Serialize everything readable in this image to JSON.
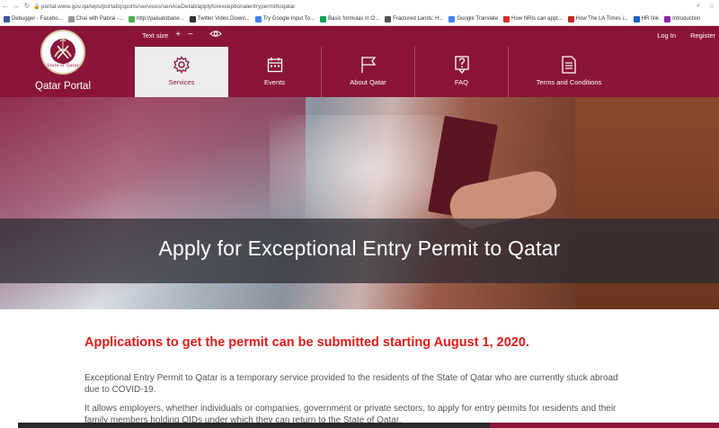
{
  "browser": {
    "url": "portal.www.gov.qa/wps/portal/qsports/services/serviceDetail/applyforexceptionalentrypermittoqatar",
    "bookmarks": [
      {
        "label": "Debugger - Facebo...",
        "color": "#3b5998"
      },
      {
        "label": "Chai with Pabrai -...",
        "color": "#999999"
      },
      {
        "label": "http://paisatobane...",
        "color": "#4caf50"
      },
      {
        "label": "Twitter Video Downl...",
        "color": "#333333"
      },
      {
        "label": "Try Google Input To...",
        "color": "#4285f4"
      },
      {
        "label": "Basic formulas in O...",
        "color": "#0f9d58"
      },
      {
        "label": "Fractured Lands: H...",
        "color": "#555555"
      },
      {
        "label": "Google Translate",
        "color": "#4285f4"
      },
      {
        "label": "How NRIs can appl...",
        "color": "#d32f2f"
      },
      {
        "label": "How The LA Times i...",
        "color": "#c62828"
      },
      {
        "label": "HR link",
        "color": "#1565c0"
      },
      {
        "label": "Introduction",
        "color": "#8e24aa"
      }
    ]
  },
  "header": {
    "portal_title": "Qatar Portal",
    "emblem_text": "State of Qatar",
    "text_size_label": "Text size",
    "text_size_plus": "+",
    "text_size_minus": "−",
    "login_label": "Log In",
    "register_label": "Register",
    "brand_color": "#8a1538"
  },
  "tabs": [
    {
      "label": "Services",
      "icon": "gear-icon",
      "active": true
    },
    {
      "label": "Events",
      "icon": "calendar-icon",
      "active": false
    },
    {
      "label": "About Qatar",
      "icon": "flag-icon",
      "active": false
    },
    {
      "label": "FAQ",
      "icon": "question-icon",
      "active": false
    },
    {
      "label": "Terms and Conditions",
      "icon": "document-icon",
      "active": false
    }
  ],
  "hero": {
    "title": "Apply for Exceptional Entry Permit to Qatar"
  },
  "content": {
    "notice": "Applications to get the permit can be submitted starting August 1, 2020.",
    "notice_color": "#e31b1b",
    "paragraph_1": "Exceptional Entry Permit to Qatar is a temporary service provided to the residents of the State of Qatar who are currently stuck abroad due to COVID-19.",
    "paragraph_2": "It allows employers, whether individuals or companies, government or private sectors, to apply for entry permits for residents and their family members holding QIDs under which they can return to the State of Qatar."
  }
}
